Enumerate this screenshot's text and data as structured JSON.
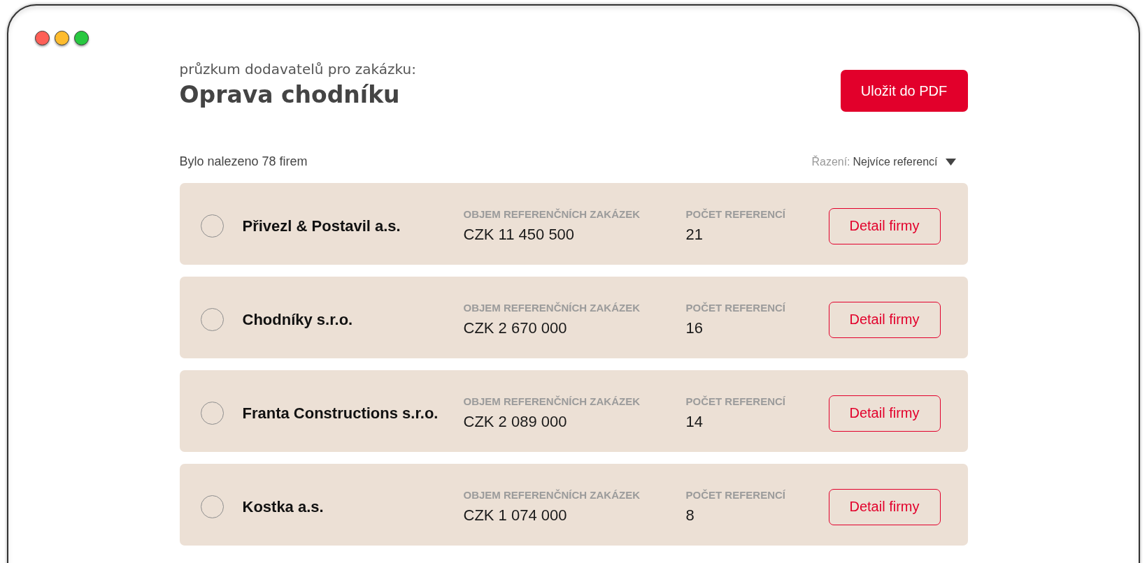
{
  "window": {
    "controls": [
      {
        "color": "#fe5f57"
      },
      {
        "color": "#febc2e"
      },
      {
        "color": "#28c840"
      }
    ]
  },
  "header": {
    "subtitle": "průzkum dodavatelů pro zakázku:",
    "title": "Oprava chodníku",
    "save_button": "Uložit do PDF"
  },
  "results": {
    "summary": "Bylo nalezeno 78 firem",
    "sort_label": "Řazení:",
    "sort_value": "Nejvíce referencí"
  },
  "companies": [
    {
      "name": "Přivezl & Postavil a.s.",
      "selected": false,
      "volume_label": "OBJEM REFERENČNÍCH ZAKÁZEK",
      "volume": "CZK 11 450 500",
      "count_label": "POČET REFERENCÍ",
      "count": "21",
      "button": "Detail firmy"
    },
    {
      "name": "Chodníky s.r.o.",
      "selected": false,
      "volume_label": "OBJEM REFERENČNÍCH ZAKÁZEK",
      "volume": "CZK 2 670 000",
      "count_label": "POČET REFERENCÍ",
      "count": "16",
      "button": "Detail firmy"
    },
    {
      "name": "Franta Constructions s.r.o.",
      "selected": false,
      "volume_label": "OBJEM REFERENČNÍCH ZAKÁZEK",
      "volume": "CZK 2 089 000",
      "count_label": "POČET REFERENCÍ",
      "count": "14",
      "button": "Detail firmy"
    },
    {
      "name": "Kostka a.s.",
      "selected": false,
      "volume_label": "OBJEM REFERENČNÍCH ZAKÁZEK",
      "volume": "CZK 1 074 000",
      "count_label": "POČET REFERENCÍ",
      "count": "8",
      "button": "Detail firmy"
    }
  ]
}
